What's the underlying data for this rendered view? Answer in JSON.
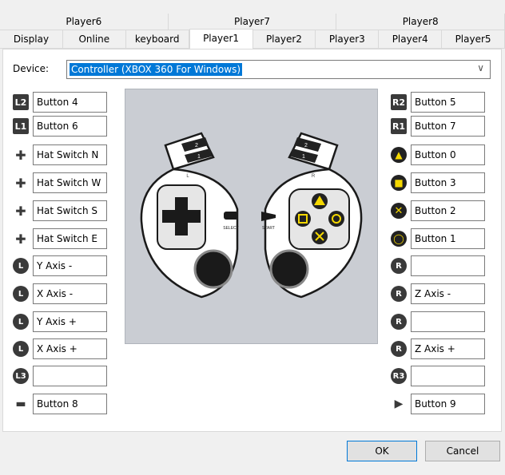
{
  "tabs_top": [
    "Player6",
    "Player7",
    "Player8"
  ],
  "tabs_bottom": [
    "Display",
    "Online",
    "keyboard",
    "Player1",
    "Player2",
    "Player3",
    "Player4",
    "Player5"
  ],
  "active_tab": "Player1",
  "device": {
    "label": "Device:",
    "value": "Controller (XBOX 360 For Windows)"
  },
  "left_bindings": [
    {
      "icon": "L2",
      "value": "Button 4"
    },
    {
      "icon": "L1",
      "value": "Button 6"
    },
    {
      "icon": "hat-up",
      "value": "Hat Switch N"
    },
    {
      "icon": "hat-left",
      "value": "Hat Switch W"
    },
    {
      "icon": "hat-down",
      "value": "Hat Switch S"
    },
    {
      "icon": "hat-right",
      "value": "Hat Switch E"
    },
    {
      "icon": "L-stick-up",
      "value": "Y Axis -"
    },
    {
      "icon": "L-stick-left",
      "value": "X Axis -"
    },
    {
      "icon": "L-stick-down",
      "value": "Y Axis +"
    },
    {
      "icon": "L-stick-right",
      "value": "X Axis +"
    },
    {
      "icon": "L3",
      "value": ""
    },
    {
      "icon": "select",
      "value": "Button 8"
    }
  ],
  "right_bindings": [
    {
      "icon": "R2",
      "value": "Button 5"
    },
    {
      "icon": "R1",
      "value": "Button 7"
    },
    {
      "icon": "triangle",
      "value": "Button 0"
    },
    {
      "icon": "square",
      "value": "Button 3"
    },
    {
      "icon": "cross",
      "value": "Button 2"
    },
    {
      "icon": "circle",
      "value": "Button 1"
    },
    {
      "icon": "R-stick-up",
      "value": ""
    },
    {
      "icon": "R-stick-left",
      "value": "Z Axis -"
    },
    {
      "icon": "R-stick-down",
      "value": ""
    },
    {
      "icon": "R-stick-right",
      "value": "Z Axis +"
    },
    {
      "icon": "R3",
      "value": ""
    },
    {
      "icon": "start",
      "value": "Button 9"
    }
  ],
  "gamepad_labels": {
    "l2": "2",
    "l1": "1",
    "r2": "2",
    "r1": "1",
    "l": "L",
    "r": "R",
    "select": "SELECT",
    "start": "START"
  },
  "buttons": {
    "ok": "OK",
    "cancel": "Cancel"
  },
  "colors": {
    "accent": "#0078d7",
    "face_button_yellow": "#f5d800",
    "pad_background": "#cacdd3"
  }
}
